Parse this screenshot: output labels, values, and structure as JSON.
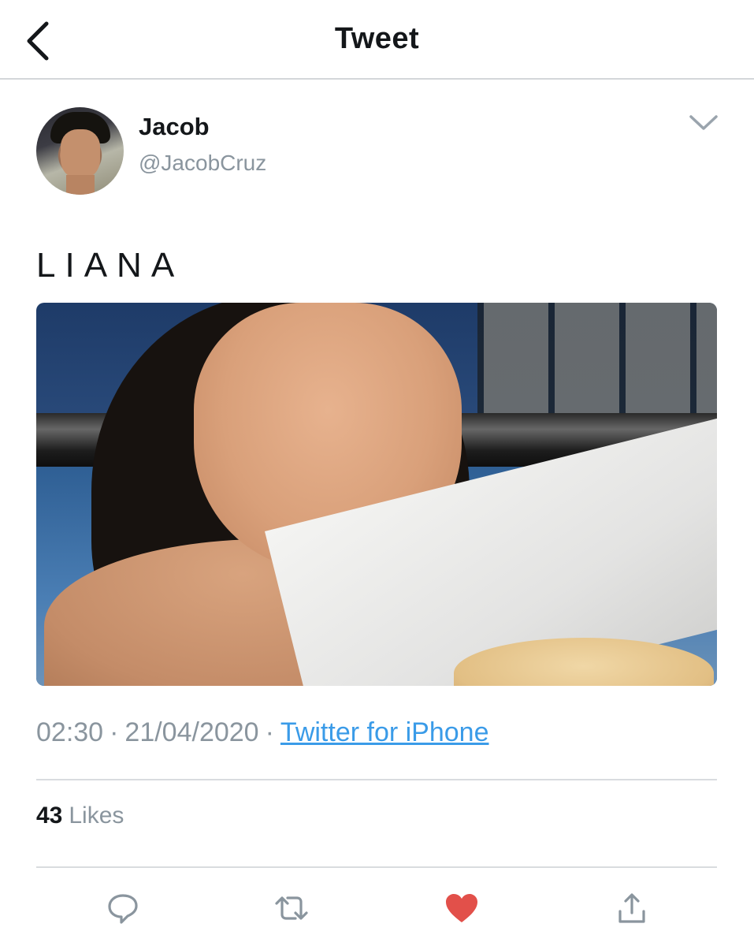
{
  "header": {
    "title": "Tweet",
    "back_icon": "chevron-left-icon"
  },
  "tweet": {
    "author": {
      "display_name": "Jacob",
      "handle": "@JacobCruz"
    },
    "text": "LIANA",
    "timestamp": {
      "time": "02:30",
      "separator": "·",
      "date": "21/04/2020",
      "source": "Twitter for iPhone"
    },
    "stats": {
      "likes_count": "43",
      "likes_label": "Likes"
    }
  },
  "actions": {
    "reply_icon": "reply-icon",
    "retweet_icon": "retweet-icon",
    "like_icon": "heart-icon",
    "share_icon": "share-icon"
  },
  "colors": {
    "link": "#3a9be8",
    "like_active": "#e0245e",
    "secondary_text": "#8a959e",
    "icon_gray": "#8a959e"
  }
}
